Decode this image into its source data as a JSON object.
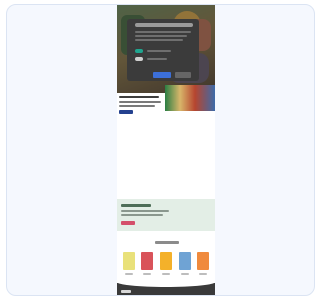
{
  "viewer": {
    "background": "#f5f8fe",
    "border": "#dbe4f3"
  },
  "hero": {
    "colors": [
      "#6f8d63",
      "#8d7a4e",
      "#5a4a3a"
    ]
  },
  "cookie_modal": {
    "background": "#3b3b3b",
    "toggles": [
      {
        "name": "toggle-necessary",
        "state": "on"
      },
      {
        "name": "toggle-analytics",
        "state": "off"
      }
    ],
    "accent": "#1fa58f",
    "button_primary_color": "#3c6fd8"
  },
  "section_cta_color": "#24418f",
  "notice": {
    "background": "#e3eee6",
    "button_color": "#d44f6a"
  },
  "books": [
    {
      "color": "#e9e17a"
    },
    {
      "color": "#d9535a"
    },
    {
      "color": "#f4b12a"
    },
    {
      "color": "#6fa3d4"
    },
    {
      "color": "#f08a3d"
    }
  ],
  "footer": {
    "background": "#3a3a3a"
  }
}
